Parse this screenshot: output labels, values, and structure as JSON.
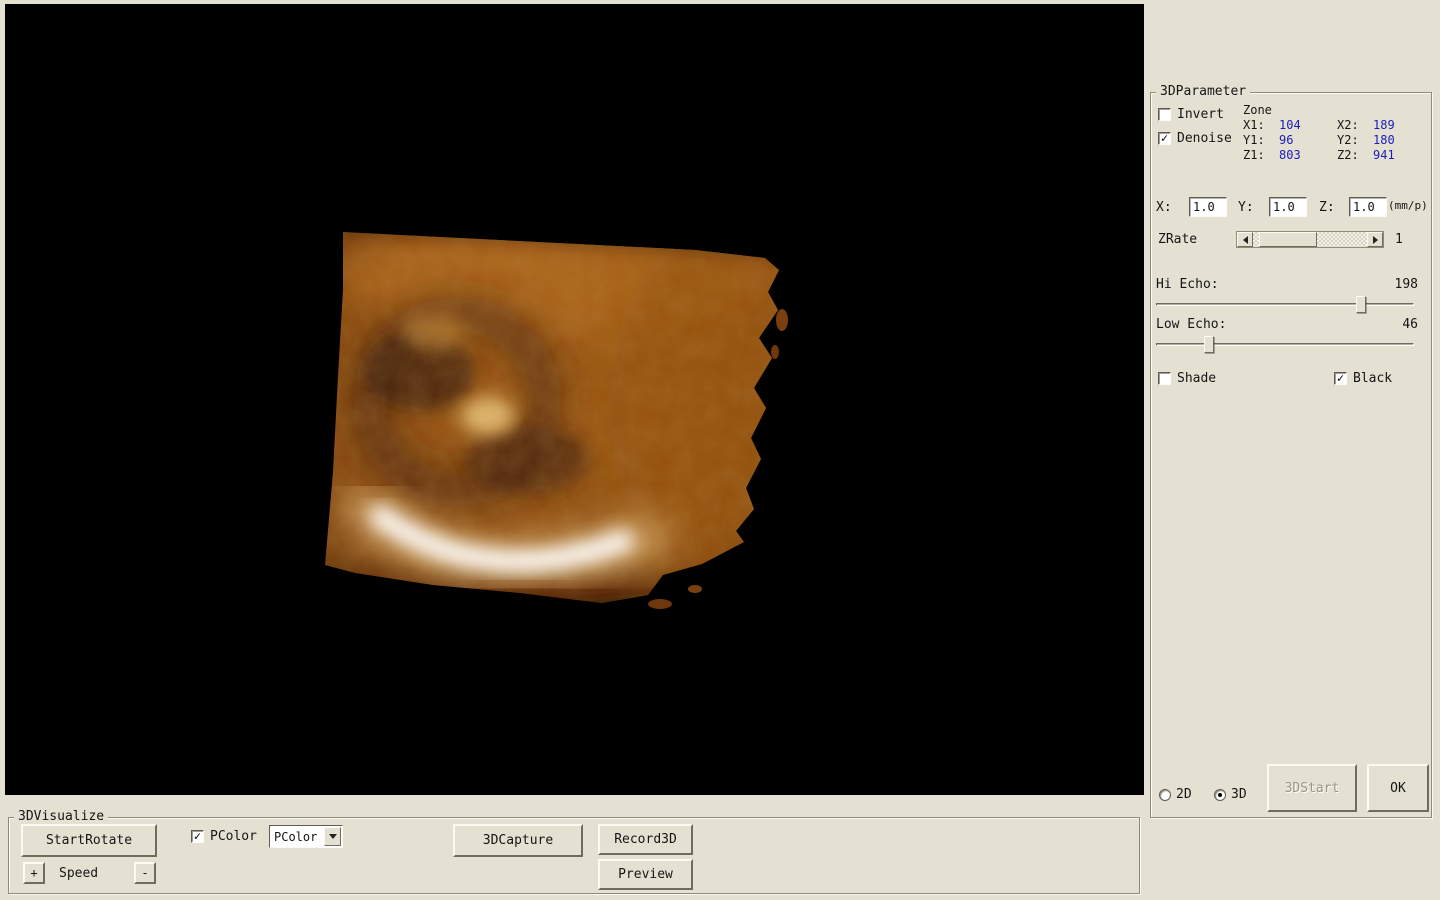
{
  "colors": {
    "background": "#e5e1d2",
    "viewport_bg": "#000000",
    "value_blue": "#1b1bbd",
    "volume_amber": "#a05a14"
  },
  "param_panel": {
    "title": "3DParameter",
    "invert": {
      "label": "Invert",
      "checked": ""
    },
    "denoise": {
      "label": "Denoise",
      "checked": "✓"
    },
    "zone": {
      "title": "Zone",
      "x1_label": "X1:",
      "x1_value": "104",
      "x2_label": "X2:",
      "x2_value": "189",
      "y1_label": "Y1:",
      "y1_value": "96",
      "y2_label": "Y2:",
      "y2_value": "180",
      "z1_label": "Z1:",
      "z1_value": "803",
      "z2_label": "Z2:",
      "z2_value": "941"
    },
    "scale": {
      "x_label": "X:",
      "x_value": "1.0",
      "y_label": "Y:",
      "y_value": "1.0",
      "z_label": "Z:",
      "z_value": "1.0",
      "unit": "(mm/p)"
    },
    "zrate": {
      "label": "ZRate",
      "value": "1"
    },
    "hi_echo": {
      "label": "Hi Echo:",
      "value": "198"
    },
    "low_echo": {
      "label": "Low Echo:",
      "value": "46"
    },
    "shade": {
      "label": "Shade",
      "checked": ""
    },
    "black": {
      "label": "Black",
      "checked": "✓"
    },
    "mode_2d": {
      "label": "2D"
    },
    "mode_3d": {
      "label": "3D"
    },
    "buttons": {
      "start3d": "3DStart",
      "ok": "OK"
    }
  },
  "visualize_panel": {
    "title": "3DVisualize",
    "start_rotate": "StartRotate",
    "pcolor": {
      "label": "PColor",
      "checked": "✓",
      "selected_option": "PColor"
    },
    "capture": "3DCapture",
    "record": "Record3D",
    "preview": "Preview",
    "speed": {
      "plus": "+",
      "label": "Speed",
      "minus": "-"
    }
  }
}
